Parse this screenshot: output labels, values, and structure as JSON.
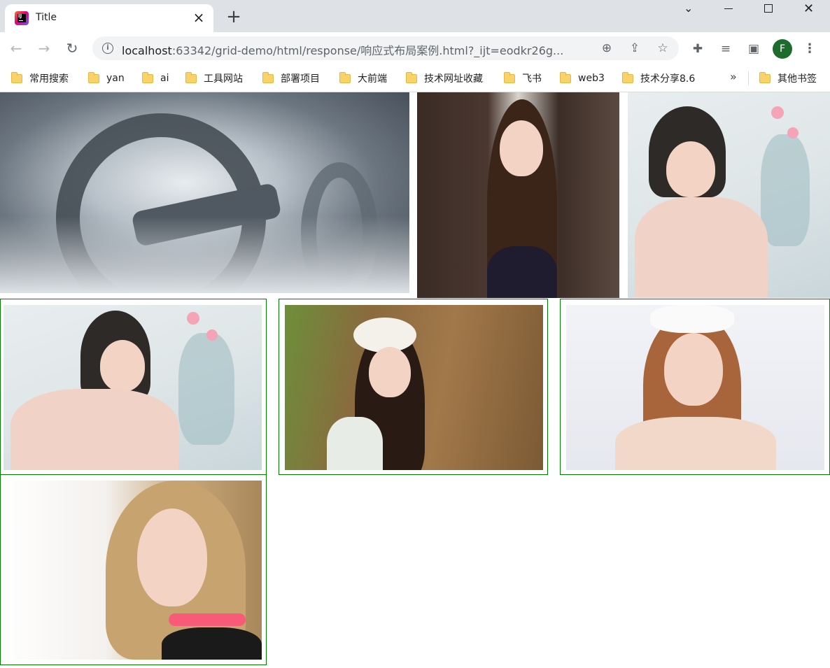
{
  "tab": {
    "title": "Title",
    "close_icon": "close-icon",
    "favicon": "intellij-icon"
  },
  "new_tab_icon": "plus-icon",
  "window_controls": {
    "chevron": "chevron-down-icon",
    "minimize": "minimize-icon",
    "maximize": "maximize-icon",
    "close": "close-icon"
  },
  "toolbar": {
    "back_icon": "back-arrow-icon",
    "forward_icon": "forward-arrow-icon",
    "reload_icon": "reload-icon",
    "url_host": "localhost",
    "url_rest": ":63342/grid-demo/html/response/响应式布局案例.html?_ijt=eodkr26g...",
    "avatar_letter": "F",
    "avatar_color": "#1e6b2e"
  },
  "bookmarks": [
    "常用搜索",
    "yan",
    "ai",
    "工具网站",
    "部署项目",
    "大前端",
    "技术网址收藏",
    "飞书",
    "web3",
    "技术分享8.6"
  ],
  "bookmarks_more": "»",
  "bookmarks_other": "其他书签",
  "content": {
    "border_color": "#008000",
    "images": [
      {
        "name": "sci-fi-ring-image",
        "subject": "sci-fi space station"
      },
      {
        "name": "girl-doorway-image",
        "subject": "portrait"
      },
      {
        "name": "girl-flowers-image",
        "subject": "portrait"
      },
      {
        "name": "girl-flowers-image-2",
        "subject": "portrait"
      },
      {
        "name": "girl-white-hat-image",
        "subject": "portrait"
      },
      {
        "name": "girl-headband-image",
        "subject": "portrait"
      },
      {
        "name": "blonde-woman-image",
        "subject": "portrait"
      }
    ]
  }
}
